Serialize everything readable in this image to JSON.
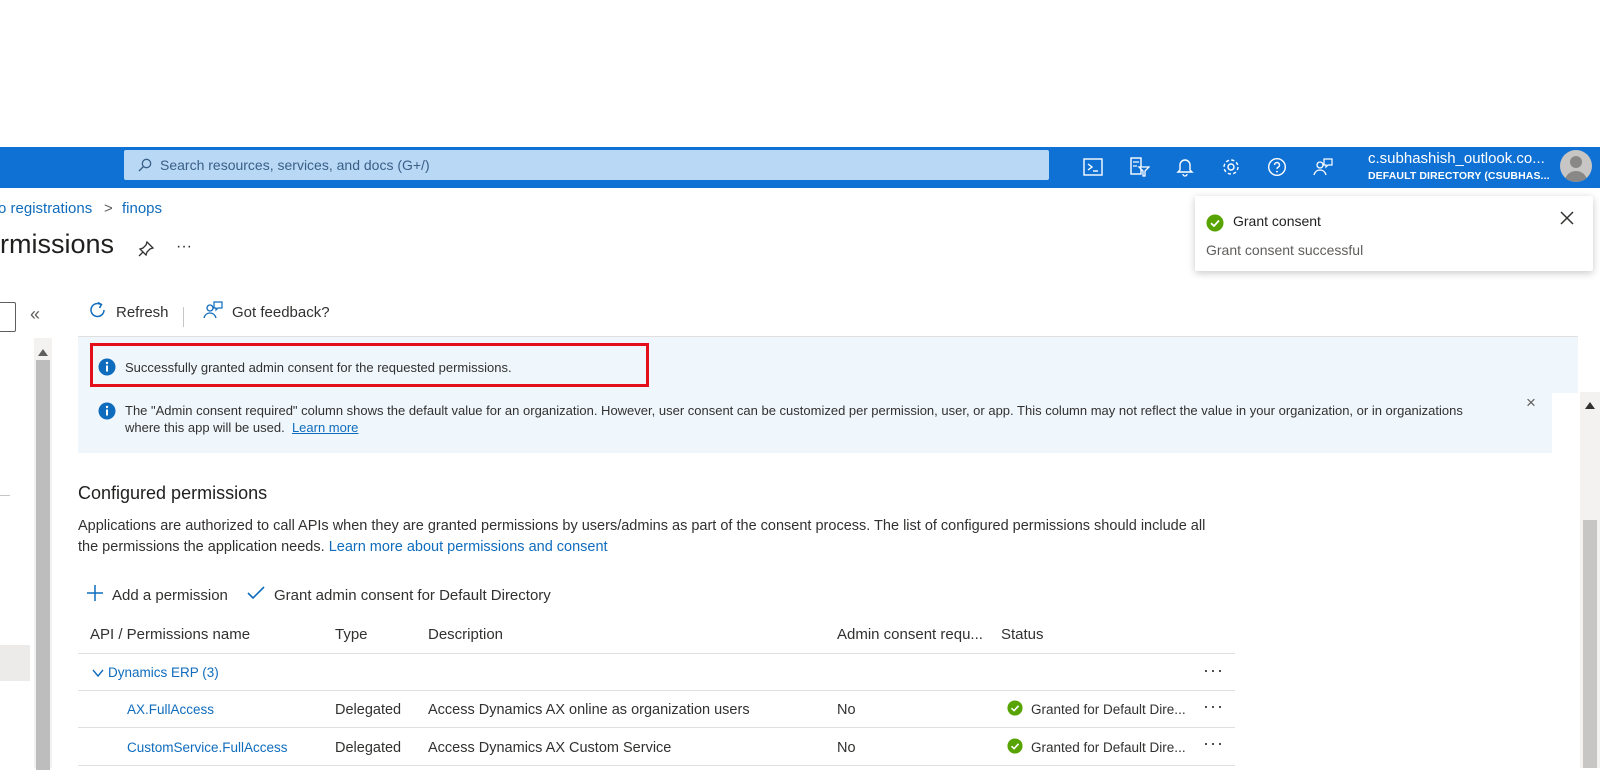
{
  "header": {
    "search_placeholder": "Search resources, services, and docs (G+/)",
    "user_name": "c.subhashish_outlook.co...",
    "user_directory": "DEFAULT DIRECTORY (CSUBHAS..."
  },
  "breadcrumb": {
    "items": [
      "o registrations",
      "finops"
    ],
    "separator": ">"
  },
  "page": {
    "title": "rmissions",
    "more": "···"
  },
  "toast": {
    "title": "Grant consent",
    "message": "Grant consent successful"
  },
  "left": {
    "collapse": "«"
  },
  "toolbar": {
    "refresh_label": "Refresh",
    "feedback_label": "Got feedback?"
  },
  "banners": {
    "success_text": "Successfully granted admin consent for the requested permissions.",
    "info_text": "The \"Admin consent required\" column shows the default value for an organization. However, user consent can be customized per permission, user, or app. This column may not reflect the value in your organization, or in organizations where this app will be used.",
    "info_link": "Learn more",
    "close": "×"
  },
  "configured": {
    "title": "Configured permissions",
    "description": "Applications are authorized to call APIs when they are granted permissions by users/admins as part of the consent process. The list of configured permissions should include all the permissions the application needs.",
    "description_link": "Learn more about permissions and consent",
    "add_permission_label": "Add a permission",
    "grant_consent_label": "Grant admin consent for Default Directory"
  },
  "table": {
    "headers": [
      "API / Permissions name",
      "Type",
      "Description",
      "Admin consent requ...",
      "Status"
    ],
    "group": {
      "label": "Dynamics ERP (3)",
      "more": "···"
    },
    "rows": [
      {
        "name": "AX.FullAccess",
        "type": "Delegated",
        "description": "Access Dynamics AX online as organization users",
        "admin": "No",
        "status": "Granted for Default Dire...",
        "more": "···"
      },
      {
        "name": "CustomService.FullAccess",
        "type": "Delegated",
        "description": "Access Dynamics AX Custom Service",
        "admin": "No",
        "status": "Granted for Default Dire...",
        "more": "···"
      }
    ]
  },
  "colors": {
    "topbar": "#1071d4",
    "link": "#0f6cbd",
    "info_bg": "#eff6fc",
    "highlight": "#e3101c",
    "success": "#57a300"
  }
}
